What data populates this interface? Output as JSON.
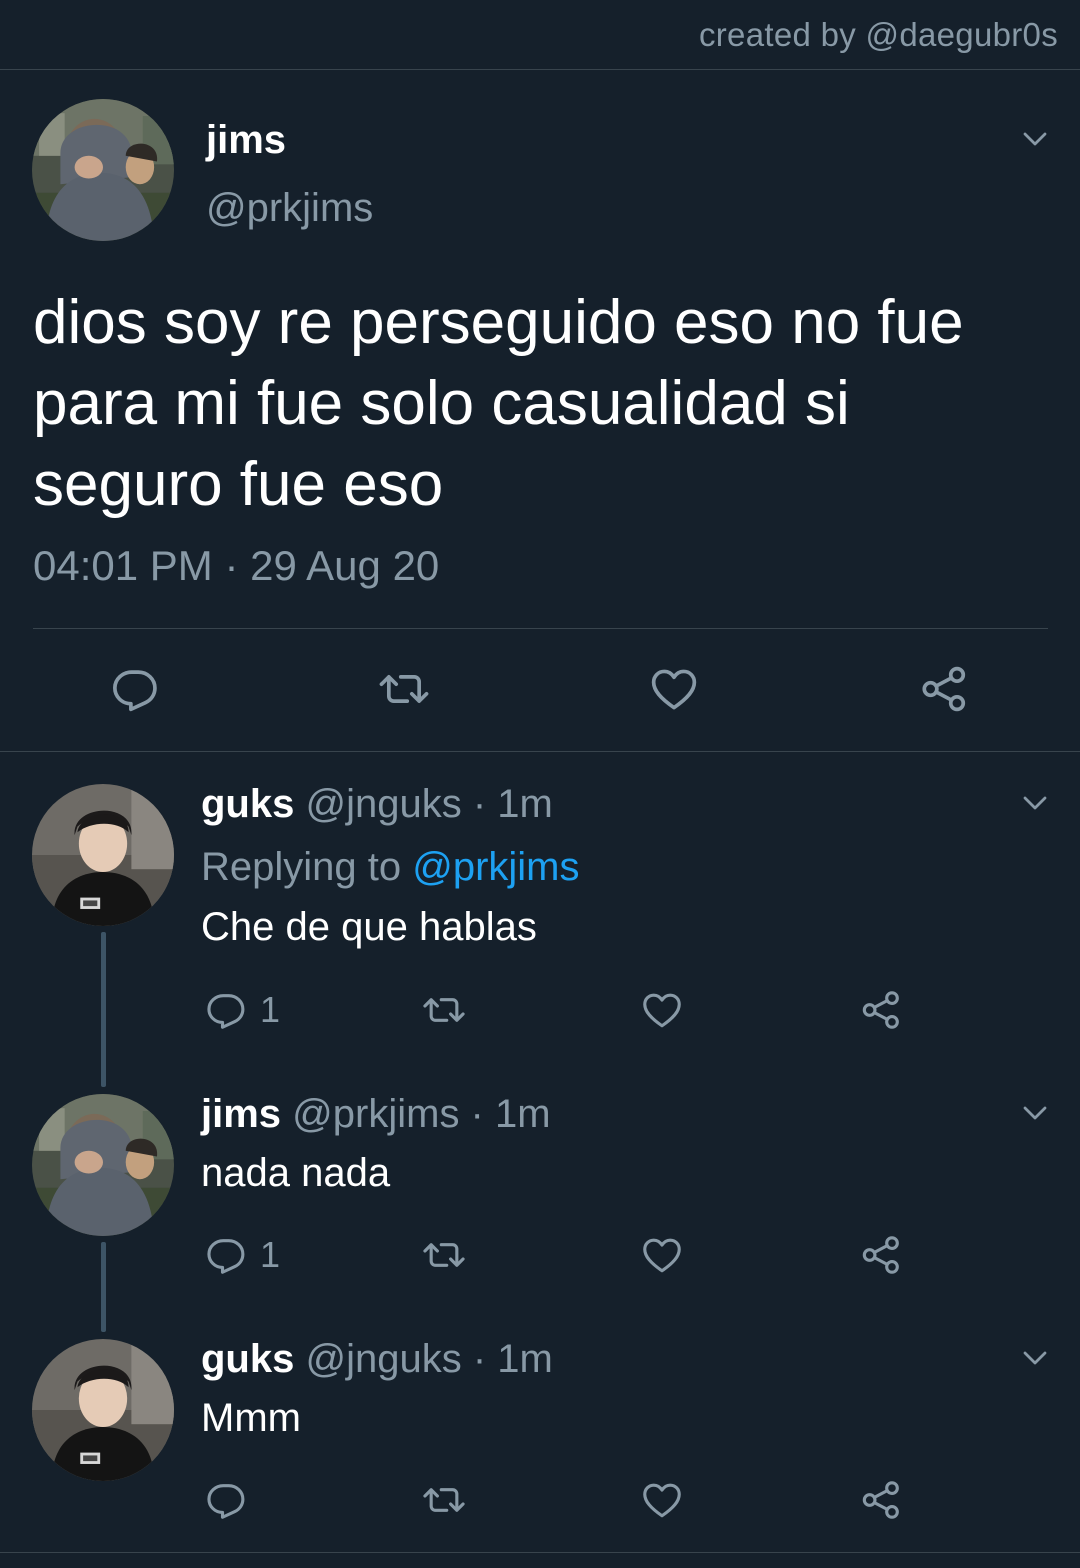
{
  "credit": "created by @daegubr0s",
  "main_tweet": {
    "name": "jims",
    "handle": "@prkjims",
    "text": "dios soy re perseguido eso no fue para mi fue solo casualidad si seguro fue eso",
    "timestamp": "04:01 PM · 29 Aug 20",
    "icons": [
      "reply-icon",
      "retweet-icon",
      "like-icon",
      "share-icon",
      "chevron-down-icon"
    ]
  },
  "replies": [
    {
      "name": "guks",
      "handle": "@jnguks · 1m",
      "replying_prefix": "Replying to ",
      "replying_to": "@prkjims",
      "text": "Che de que hablas",
      "reply_count": "1",
      "avatar": "guks-avatar"
    },
    {
      "name": "jims",
      "handle": "@prkjims · 1m",
      "text": "nada nada",
      "reply_count": "1",
      "avatar": "jims-avatar"
    },
    {
      "name": "guks",
      "handle": "@jnguks · 1m",
      "text": "Mmm",
      "reply_count": "",
      "avatar": "guks-avatar"
    }
  ],
  "colors": {
    "background": "#15202b",
    "divider": "#38444d",
    "secondary_text": "#8899a6",
    "link": "#1da1f2",
    "thread_line": "#3d5466"
  }
}
